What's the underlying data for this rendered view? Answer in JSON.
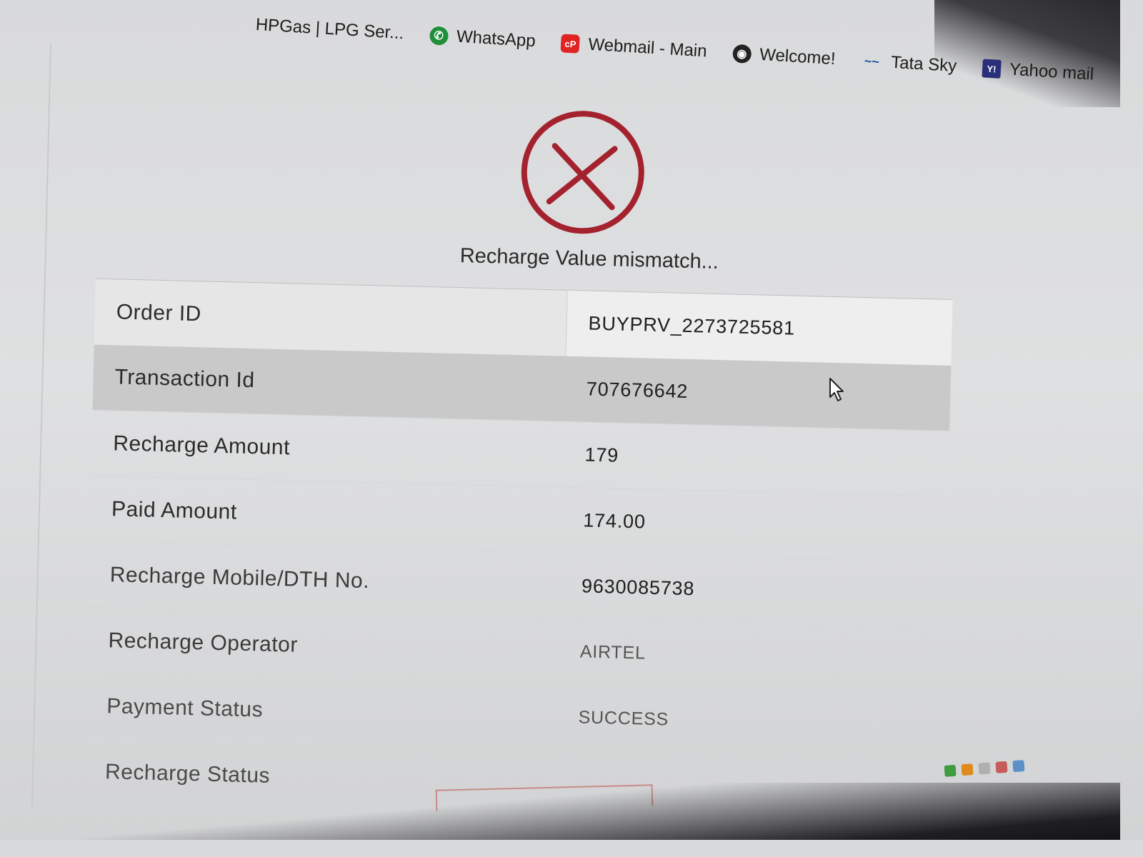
{
  "bookmarks": [
    {
      "label": "HPGas | LPG Ser...",
      "icon": "hpgas-icon"
    },
    {
      "label": "WhatsApp",
      "icon": "whatsapp-icon"
    },
    {
      "label": "Webmail - Main",
      "icon": "webmail-icon"
    },
    {
      "label": "Welcome!",
      "icon": "globe-icon"
    },
    {
      "label": "Tata Sky",
      "icon": "tatasky-icon"
    },
    {
      "label": "Yahoo mail",
      "icon": "yahoo-icon"
    }
  ],
  "status": {
    "icon": "error-x-icon",
    "color": "#a3222e",
    "message": "Recharge Value mismatch..."
  },
  "details": [
    {
      "label": "Order ID",
      "value": "BUYPRV_2273725581"
    },
    {
      "label": "Transaction Id",
      "value": "707676642"
    },
    {
      "label": "Recharge Amount",
      "value": "179"
    },
    {
      "label": "Paid Amount",
      "value": "174.00"
    },
    {
      "label": "Recharge Mobile/DTH No.",
      "value": "9630085738"
    },
    {
      "label": "Recharge Operator",
      "value": "AIRTEL"
    },
    {
      "label": "Payment Status",
      "value": "SUCCESS"
    },
    {
      "label": "Recharge Status",
      "value": ""
    }
  ]
}
